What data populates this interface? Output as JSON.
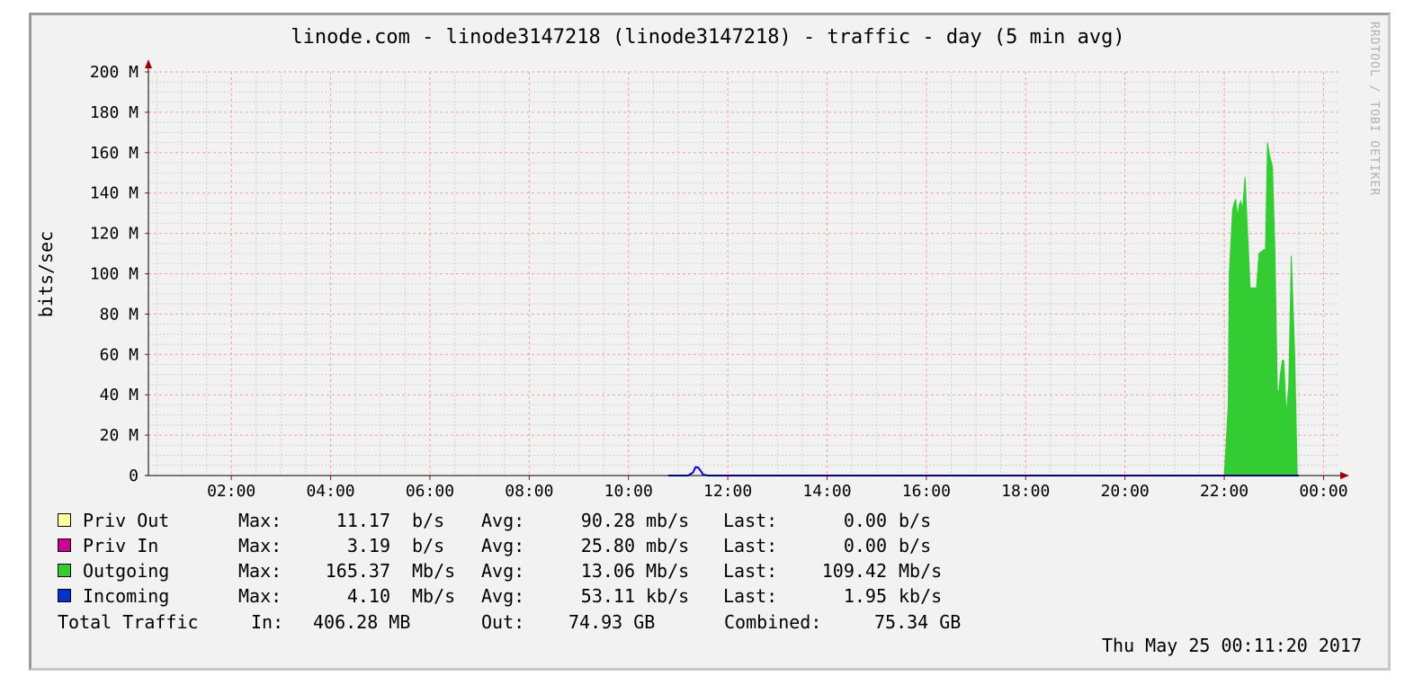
{
  "watermark": "RRDTOOL / TOBI OETIKER",
  "timestamp": "Thu May 25 00:11:20 2017",
  "chart_data": {
    "type": "area",
    "title": "linode.com - linode3147218 (linode3147218) - traffic - day (5 min avg)",
    "ylabel": "bits/sec",
    "xlabel": "",
    "ylim": [
      0,
      200000000
    ],
    "xlim": [
      0.33,
      24.3
    ],
    "y_ticks": [
      0,
      20000000,
      40000000,
      60000000,
      80000000,
      100000000,
      120000000,
      140000000,
      160000000,
      180000000,
      200000000
    ],
    "y_tick_labels": [
      "0",
      "20 M",
      "40 M",
      "60 M",
      "80 M",
      "100 M",
      "120 M",
      "140 M",
      "160 M",
      "180 M",
      "200 M"
    ],
    "x_ticks": [
      2,
      4,
      6,
      8,
      10,
      12,
      14,
      16,
      18,
      20,
      22,
      24
    ],
    "x_tick_labels": [
      "02:00",
      "04:00",
      "06:00",
      "08:00",
      "10:00",
      "12:00",
      "14:00",
      "16:00",
      "18:00",
      "20:00",
      "22:00",
      "00:00"
    ],
    "grid": true,
    "series": [
      {
        "name": "Outgoing",
        "color": "#33cc33",
        "style": "area",
        "x": [
          22.0,
          22.08,
          22.1,
          22.17,
          22.2,
          22.23,
          22.27,
          22.3,
          22.33,
          22.37,
          22.42,
          22.47,
          22.52,
          22.55,
          22.6,
          22.65,
          22.7,
          22.8,
          22.83,
          22.87,
          22.92,
          22.97,
          23.02,
          23.07,
          23.1,
          23.13,
          23.17,
          23.2,
          23.25,
          23.3,
          23.35,
          23.42,
          23.47,
          23.5,
          23.52
        ],
        "y": [
          0,
          35000000,
          100000000,
          132000000,
          135000000,
          137000000,
          128000000,
          134000000,
          136000000,
          132000000,
          148000000,
          120000000,
          93000000,
          93000000,
          93000000,
          93000000,
          110000000,
          112000000,
          112000000,
          165000000,
          158000000,
          153000000,
          112000000,
          42000000,
          42000000,
          50000000,
          57000000,
          57000000,
          30000000,
          45000000,
          109000000,
          60000000,
          0,
          0,
          0
        ]
      },
      {
        "name": "Incoming",
        "color": "#0000ff",
        "style": "line",
        "x": [
          10.8,
          11.2,
          11.3,
          11.35,
          11.4,
          11.45,
          11.5,
          11.6,
          23.5
        ],
        "y": [
          0,
          0,
          1500000,
          4100000,
          4000000,
          2500000,
          500000,
          0,
          0
        ]
      },
      {
        "name": "Priv Out",
        "color": "#ffff99",
        "style": "line",
        "x": [],
        "y": []
      },
      {
        "name": "Priv In",
        "color": "#cc0099",
        "style": "line",
        "x": [],
        "y": []
      }
    ]
  },
  "legend": [
    {
      "name": "Priv Out",
      "color": "#ffff99",
      "max_label": "Max:",
      "max_value": "11.17",
      "max_unit": "b/s",
      "avg_label": "Avg:",
      "avg_value": "90.28",
      "avg_unit": "mb/s",
      "last_label": "Last:",
      "last_value": "0.00",
      "last_unit": "b/s"
    },
    {
      "name": "Priv In",
      "color": "#cc0099",
      "max_label": "Max:",
      "max_value": "3.19",
      "max_unit": "b/s",
      "avg_label": "Avg:",
      "avg_value": "25.80",
      "avg_unit": "mb/s",
      "last_label": "Last:",
      "last_value": "0.00",
      "last_unit": "b/s"
    },
    {
      "name": "Outgoing",
      "color": "#33cc33",
      "max_label": "Max:",
      "max_value": "165.37",
      "max_unit": "Mb/s",
      "avg_label": "Avg:",
      "avg_value": "13.06",
      "avg_unit": "Mb/s",
      "last_label": "Last:",
      "last_value": "109.42",
      "last_unit": "Mb/s"
    },
    {
      "name": "Incoming",
      "color": "#0033cc",
      "max_label": "Max:",
      "max_value": "4.10",
      "max_unit": "Mb/s",
      "avg_label": "Avg:",
      "avg_value": "53.11",
      "avg_unit": "kb/s",
      "last_label": "Last:",
      "last_value": "1.95",
      "last_unit": "kb/s"
    }
  ],
  "totals": {
    "label": "Total Traffic",
    "in_label": "In:",
    "in_value": "406.28 MB",
    "out_label": "Out:",
    "out_value": "74.93 GB",
    "combined_label": "Combined:",
    "combined_value": "75.34 GB"
  }
}
